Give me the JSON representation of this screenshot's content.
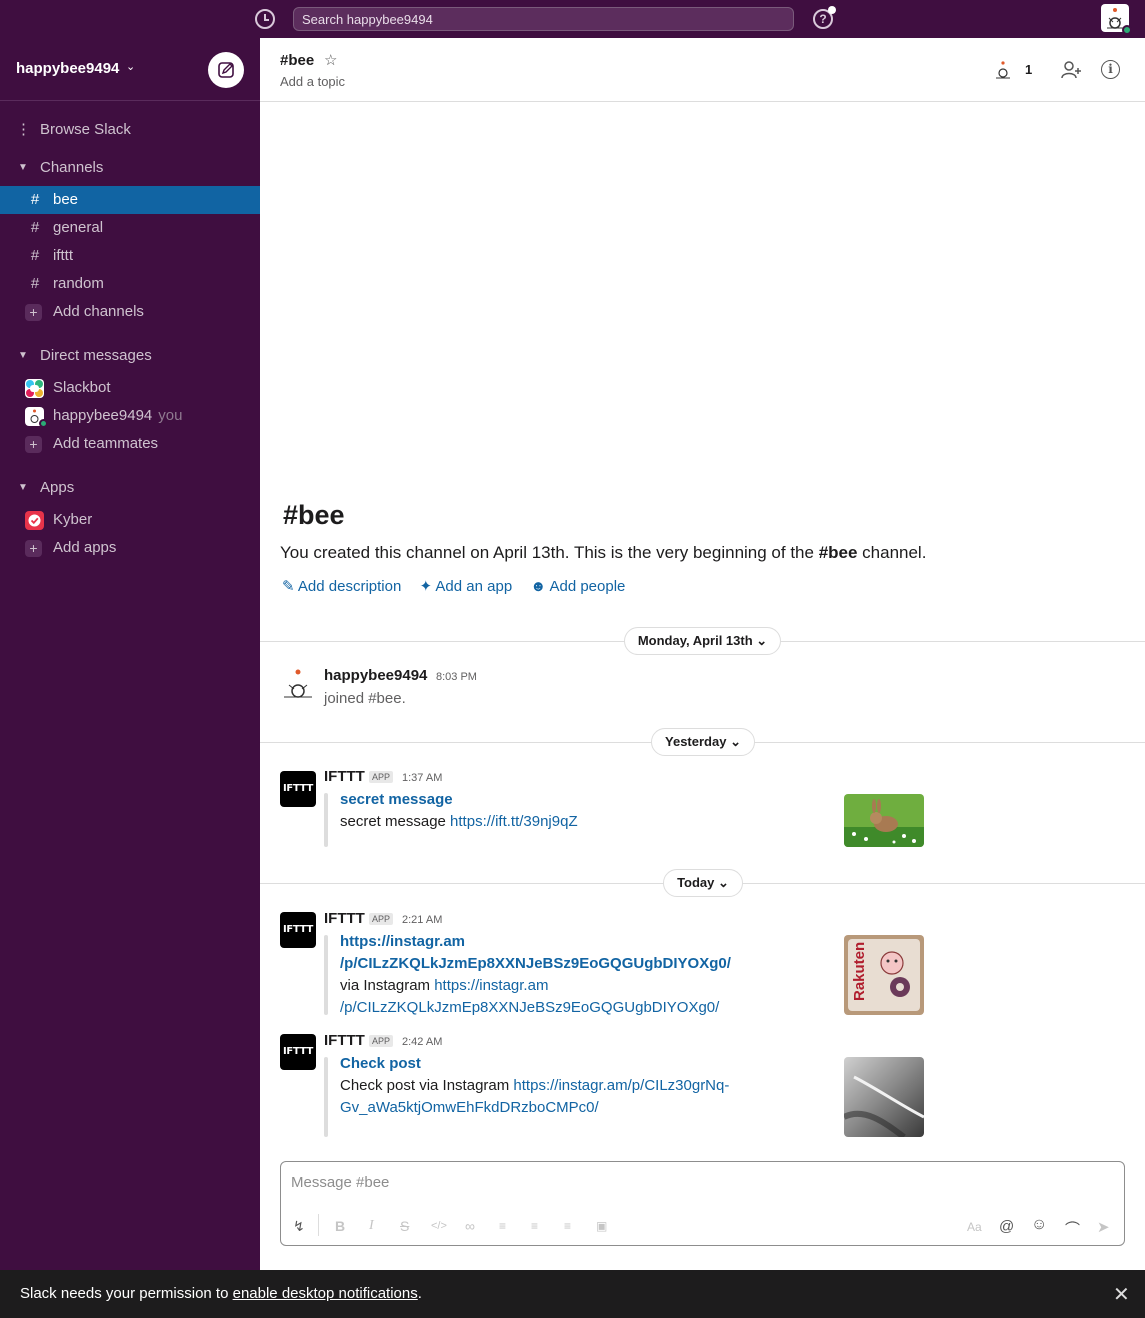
{
  "topbar": {
    "search_placeholder": "Search happybee9494"
  },
  "sidebar": {
    "workspace": "happybee9494",
    "browse": "Browse Slack",
    "channels_header": "Channels",
    "channels": [
      {
        "icon": "#",
        "label": "bee"
      },
      {
        "icon": "#",
        "label": "general"
      },
      {
        "icon": "#",
        "label": "ifttt"
      },
      {
        "icon": "#",
        "label": "random"
      }
    ],
    "add_channels": "Add channels",
    "dm_header": "Direct messages",
    "dms": [
      {
        "label": "Slackbot"
      },
      {
        "label": "happybee9494",
        "suffix": "you"
      }
    ],
    "add_teammates": "Add teammates",
    "apps_header": "Apps",
    "apps": [
      {
        "label": "Kyber"
      }
    ],
    "add_apps": "Add apps"
  },
  "channel": {
    "title": "#bee",
    "topic": "Add a topic",
    "member_count": "1"
  },
  "intro": {
    "title": "#bee",
    "text_before": "You created this channel on April 13th. This is the very beginning of the ",
    "text_channel": "#bee",
    "text_after": " channel.",
    "add_description": "Add description",
    "add_app": "Add an app",
    "add_people": "Add people"
  },
  "days": {
    "d1": "Monday, April 13th",
    "d2": "Yesterday",
    "d3": "Today"
  },
  "messages": {
    "m1": {
      "name": "happybee9494",
      "time": "8:03 PM",
      "text": "joined #bee."
    },
    "m2": {
      "name": "IFTTT",
      "badge": "APP",
      "time": "1:37 AM",
      "title": "secret message",
      "body": "secret message ",
      "link": "https://ift.tt/39nj9qZ"
    },
    "m3": {
      "name": "IFTTT",
      "badge": "APP",
      "time": "2:21 AM",
      "title_l1": "https://instagr.am",
      "title_l2": "/p/CILzZKQLkJzmEp8XXNJeBSz9EoGQGUgbDIYOXg0/",
      "body": "via Instagram ",
      "link_l1": "https://instagr.am",
      "link_l2": "/p/CILzZKQLkJzmEp8XXNJeBSz9EoGQGUgbDIYOXg0/"
    },
    "m4": {
      "name": "IFTTT",
      "badge": "APP",
      "time": "2:42 AM",
      "title": "Check post",
      "body": "Check post via Instagram ",
      "link_l1": "https://instagr.am/p/CILz30grNq-",
      "link_l2": "Gv_aWa5ktjOmwEhFkdDRzboCMPc0/"
    }
  },
  "ifttt_logo": "IFTTT",
  "thumb_text": "Rakuten",
  "composer": {
    "placeholder": "Message #bee"
  },
  "notification": {
    "before": "Slack needs your permission to ",
    "link": "enable desktop notifications",
    "after": "."
  },
  "colors": {
    "sidebar": "#3f0e40",
    "active": "#1164a3",
    "link": "#1264a3",
    "presence": "#2bac76"
  }
}
